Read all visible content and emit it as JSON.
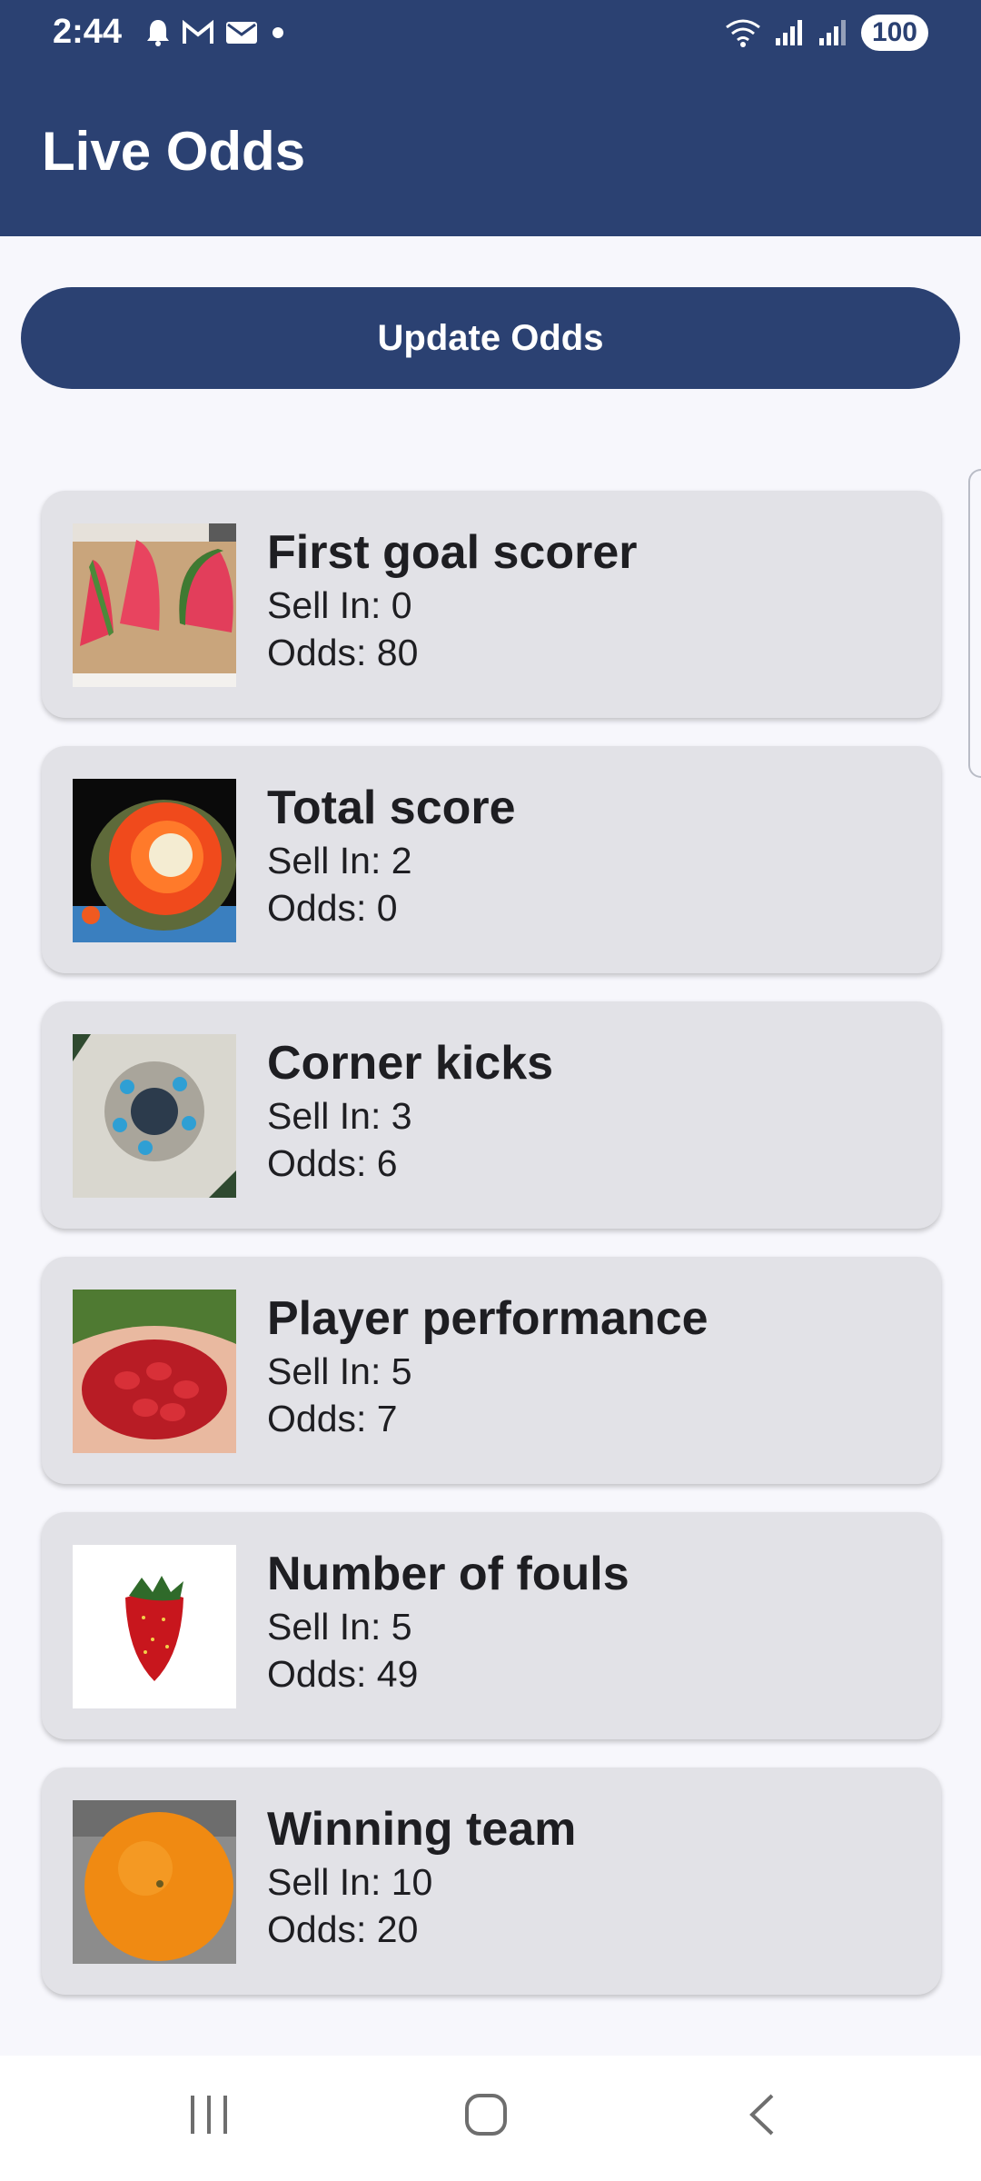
{
  "status_bar": {
    "time": "2:44",
    "battery": "100",
    "icons": [
      "bell-icon",
      "gmail-icon",
      "mail-icon",
      "dot-icon",
      "wifi-icon",
      "signal-icon",
      "signal-icon"
    ]
  },
  "app_bar": {
    "title": "Live Odds"
  },
  "update_button": {
    "label": "Update Odds"
  },
  "items": [
    {
      "title": "First goal scorer",
      "sell_in": "Sell In: 0",
      "odds": "Odds: 80",
      "image": "watermelon-slices"
    },
    {
      "title": "Total score",
      "sell_in": "Sell In: 2",
      "odds": "Odds: 0",
      "image": "red-flower"
    },
    {
      "title": "Corner kicks",
      "sell_in": "Sell In: 3",
      "odds": "Odds: 6",
      "image": "blue-decoration"
    },
    {
      "title": "Player performance",
      "sell_in": "Sell In: 5",
      "odds": "Odds: 7",
      "image": "cherry-tomatoes"
    },
    {
      "title": "Number of fouls",
      "sell_in": "Sell In: 5",
      "odds": "Odds: 49",
      "image": "strawberry"
    },
    {
      "title": "Winning team",
      "sell_in": "Sell In: 10",
      "odds": "Odds: 20",
      "image": "orange"
    }
  ],
  "nav_bar": {
    "buttons": [
      "recents-icon",
      "home-icon",
      "back-icon"
    ]
  },
  "colors": {
    "primary": "#2b4172",
    "background": "#f7f7fc",
    "card": "#e2e2e7"
  }
}
